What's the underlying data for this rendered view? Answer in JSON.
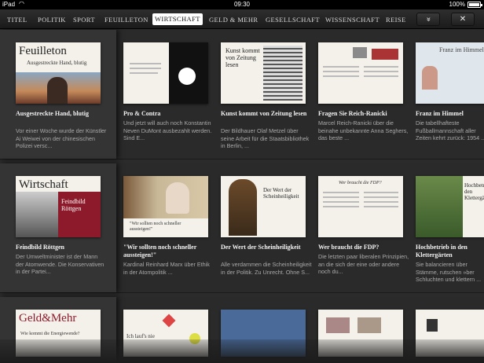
{
  "status": {
    "device": "iPad",
    "time": "09:30",
    "battery": "100%"
  },
  "nav": {
    "tabs": [
      "TITEL",
      "POLITIK",
      "SPORT",
      "FEUILLETON",
      "WIRTSCHAFT",
      "GELD & MEHR",
      "GESELLSCHAFT",
      "WISSENSCHAFT",
      "REISE"
    ],
    "active": "WIRTSCHAFT",
    "more_glyph": "»",
    "close_glyph": "✕"
  },
  "rows": [
    {
      "section": {
        "heading": "Feuilleton",
        "thumb_sub": "Ausgestreckte Hand, blutig",
        "title": "Ausgestreckte Hand, blutig",
        "desc": "Vor einer Woche wurde der Künstler Ai Weiwei von der chinesischen Polizei versc..."
      },
      "cards": [
        {
          "title": "Pro & Contra",
          "desc": "Und jetzt will auch noch Konstantin Neven DuMont ausbezahlt werden. Sind E...",
          "thumb_text": ""
        },
        {
          "title": "Kunst kommt von Zeitung lesen",
          "desc": "Der Bildhauer Olaf Metzel über seine Arbeit für die Staatsbibliothek in Berlin, ...",
          "thumb_text": "Kunst kommt von Zeitung lesen"
        },
        {
          "title": "Fragen Sie Reich-Ranicki",
          "desc": "Marcel Reich-Ranicki über die beinahe unbekannte Anna Seghers, das beste ...",
          "thumb_text": ""
        },
        {
          "title": "Franz im Himmel",
          "desc": "Die tabellhafteste Fußballmannschaft aller Zeiten kehrt zurück: 1954 ...",
          "thumb_text": "Franz im Himmel"
        }
      ]
    },
    {
      "section": {
        "heading": "Wirtschaft",
        "thumb_sub": "Feindbild Röttgen",
        "title": "Feindbild Röttgen",
        "desc": "Der Umweltminister ist der Mann der Atomwende. Die Konservativen in der Partei..."
      },
      "cards": [
        {
          "title": "\"Wir sollten noch schneller aussteigen!\"",
          "desc": "Kardinal Reinhard Marx über Ethik in der Atompolitik ...",
          "thumb_text": "\"Wir sollten noch schneller aussteigen!\""
        },
        {
          "title": "Der Wert der Scheinheiligkeit",
          "desc": "Alle verdammen die Scheinheiligkeit in der Politik. Zu Unrecht. Ohne S...",
          "thumb_text": "Der Wert der Scheinheiligkeit"
        },
        {
          "title": "Wer braucht die FDP?",
          "desc": "Die letzten paar liberalen Prinzipien, an die sich der eine oder andere noch du...",
          "thumb_text": "Wer braucht die FDP?"
        },
        {
          "title": "Hochbetrieb in den Klettergärten",
          "desc": "Sie balancieren über Stämme, rutschen »ber Schluchten und klettern ...",
          "thumb_text": "Hochbetrieb in den Klettergärten"
        }
      ]
    },
    {
      "section": {
        "heading": "Geld&Mehr",
        "thumb_sub": "Wie kommt die Energiewende?"
      },
      "cards": [
        {
          "thumb_text": "Ich lauf's nie"
        },
        {
          "thumb_text": ""
        },
        {
          "thumb_text": ""
        },
        {
          "thumb_text": ""
        }
      ]
    }
  ],
  "colors": {
    "background": "#2b2b2b",
    "section_column": "#343434",
    "active_tab": "#ffffff",
    "wirtschaft_red": "#8c1a2a"
  }
}
